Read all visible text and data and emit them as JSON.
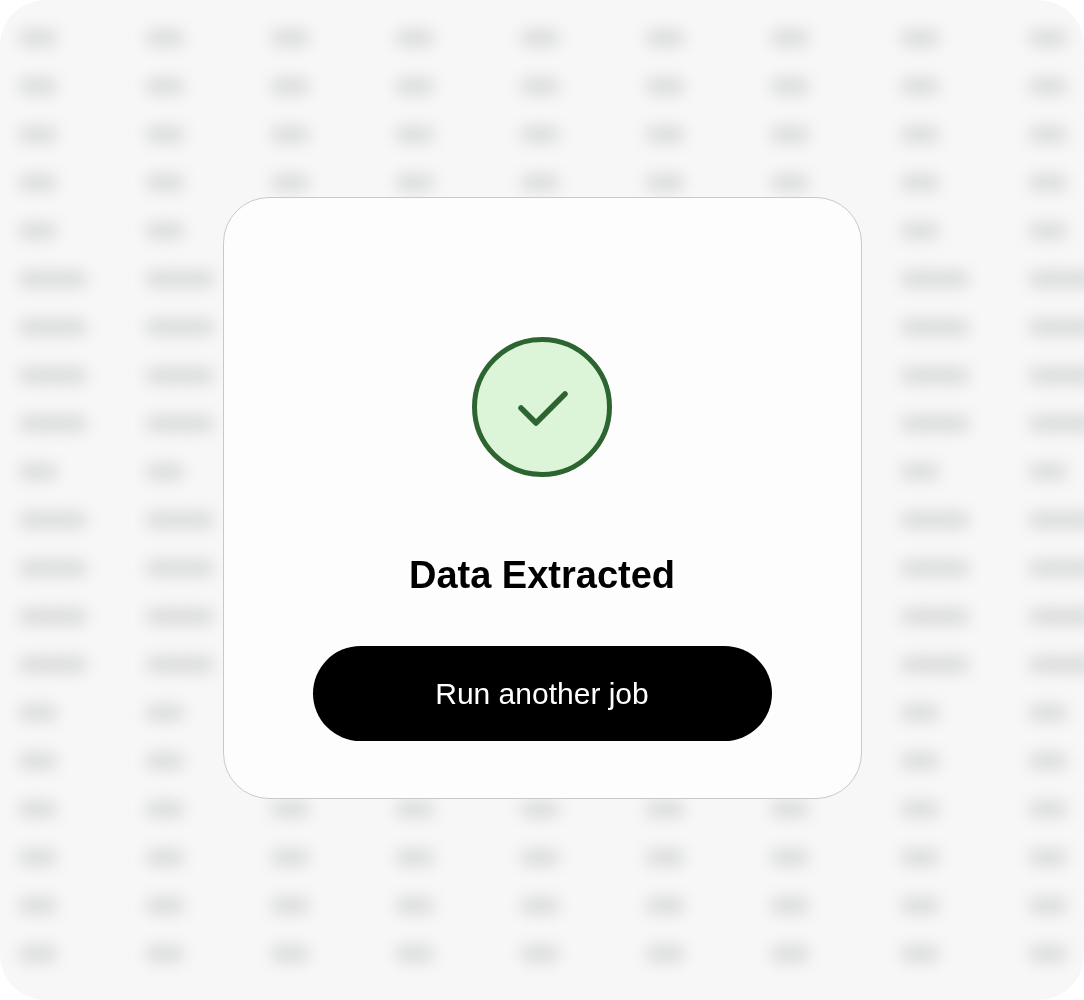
{
  "dialog": {
    "title": "Data Extracted",
    "primary_button": {
      "label": "Run another job"
    }
  }
}
